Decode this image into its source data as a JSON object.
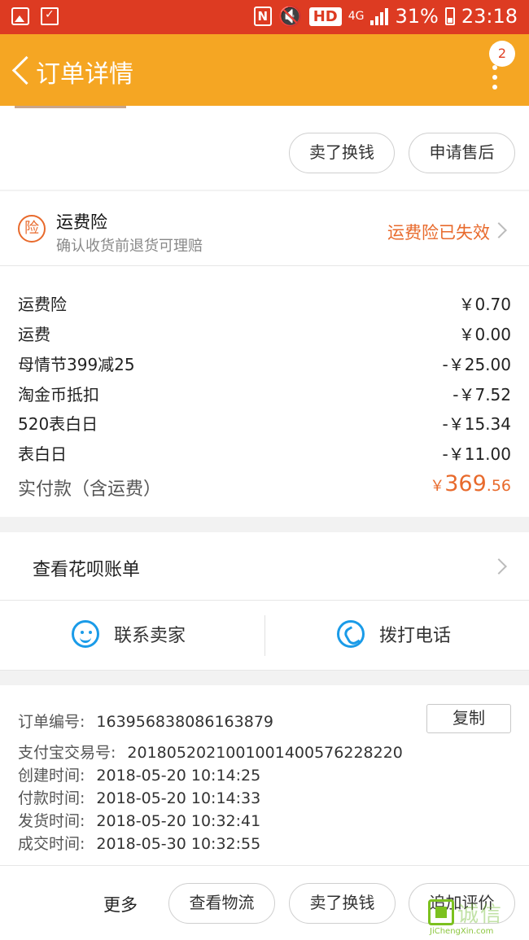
{
  "status_bar": {
    "wifi_label": "4G",
    "hd_label": "HD",
    "nfc_label": "N",
    "battery": "31%",
    "time": "23:18"
  },
  "header": {
    "title": "订单详情",
    "badge_count": "2"
  },
  "top_actions": {
    "sell_label": "卖了换钱",
    "after_sales_label": "申请售后"
  },
  "insurance": {
    "icon_char": "险",
    "name": "运费险",
    "description": "确认收货前退货可理赔",
    "status": "运费险已失效"
  },
  "fees": {
    "rows": [
      {
        "label": "运费险",
        "value": "￥0.70"
      },
      {
        "label": "运费",
        "value": "￥0.00"
      },
      {
        "label": "母情节399减25",
        "value": "-￥25.00"
      },
      {
        "label": "淘金币抵扣",
        "value": "-￥7.52"
      },
      {
        "label": "520表白日",
        "value": "-￥15.34"
      },
      {
        "label": "表白日",
        "value": "-￥11.00"
      }
    ],
    "total_label": "实付款（含运费）",
    "total_currency": "￥",
    "total_integer": "369",
    "total_decimal": ".56"
  },
  "huabei": {
    "label": "查看花呗账单"
  },
  "contact": {
    "seller_label": "联系卖家",
    "phone_label": "拨打电话"
  },
  "order_info": {
    "order_no_label": "订单编号:",
    "order_no": "163956838086163879",
    "copy_label": "复制",
    "alipay_label": "支付宝交易号:",
    "alipay_no": "2018052021001001400576228220",
    "created_label": "创建时间:",
    "created": "2018-05-20 10:14:25",
    "paid_label": "付款时间:",
    "paid": "2018-05-20 10:14:33",
    "shipped_label": "发货时间:",
    "shipped": "2018-05-20 10:32:41",
    "completed_label": "成交时间:",
    "completed": "2018-05-30 10:32:55"
  },
  "bottom_bar": {
    "more_label": "更多",
    "logistics_label": "查看物流",
    "sell_label": "卖了换钱",
    "review_label": "追加评价"
  },
  "watermark": {
    "cn": "诚信",
    "en": "JiChengXin.com"
  },
  "colors": {
    "status_bar": "#dd3b22",
    "header": "#f5a623",
    "accent_orange": "#e86a2c",
    "icon_blue": "#1a9be8"
  }
}
